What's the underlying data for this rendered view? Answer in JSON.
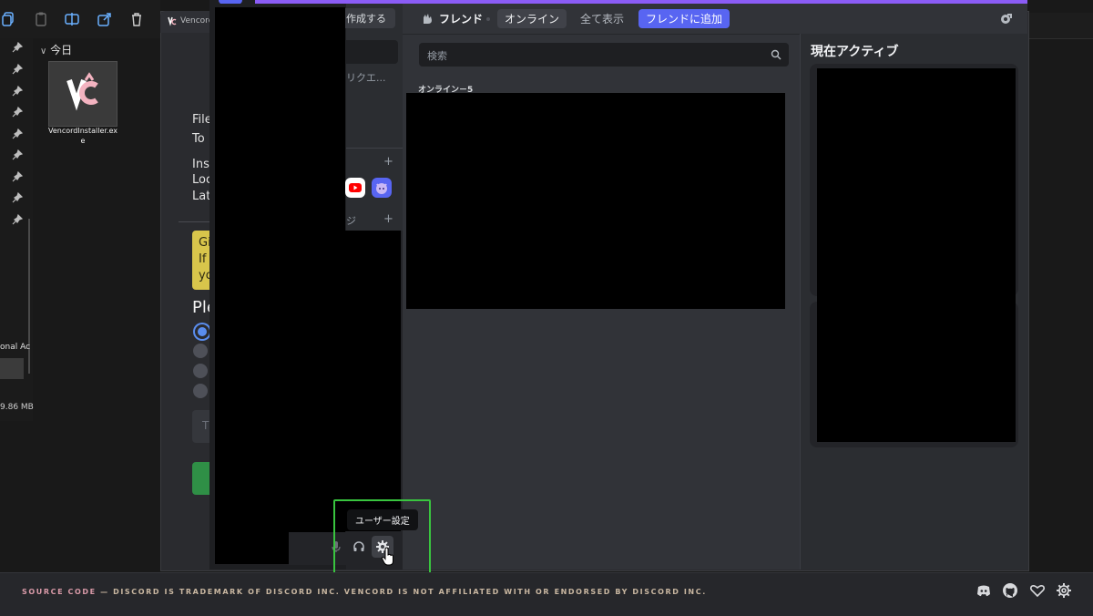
{
  "explorer": {
    "group_label": "今日",
    "file_name": "VencordInstaller.exe",
    "nav_partial_text": "onal Ac",
    "status_size": "9.86 MB"
  },
  "installer": {
    "tab_title": "Vencord",
    "info_lines": [
      "File",
      "To"
    ],
    "detail_lines": [
      "Inst",
      "Loc",
      "Lat"
    ],
    "warning_lines": [
      "Gi",
      "If",
      "yo"
    ],
    "prompt_partial": "Ple",
    "input_partial": "T"
  },
  "discord": {
    "create_button": "作成する",
    "friend_requests_partial": "リクエ...",
    "dm_section_partial": "ジ",
    "friends_label": "フレンド",
    "tabs": [
      {
        "label": "オンライン",
        "selected": true
      },
      {
        "label": "全て表示",
        "selected": false
      }
    ],
    "add_friend_button": "フレンドに追加",
    "search_placeholder": "検索",
    "online_count_label": "オンライン－5",
    "active_now_title": "現在アクティブ",
    "tooltip_user_settings": "ユーザー設定",
    "icons": {
      "friends": "friends-wave-icon",
      "inbox": "inbox-icon",
      "search": "search-icon",
      "mic": "microphone-icon",
      "headset": "headset-icon",
      "settings": "gear-icon"
    },
    "colors": {
      "accent": "#5865f2",
      "highlight_box": "#39c53f"
    }
  },
  "footer": {
    "source_code": "SOURCE CODE",
    "disclaimer": "— DISCORD IS TRADEMARK OF DISCORD INC. VENCORD IS NOT AFFILIATED WITH OR ENDORSED BY DISCORD INC."
  }
}
